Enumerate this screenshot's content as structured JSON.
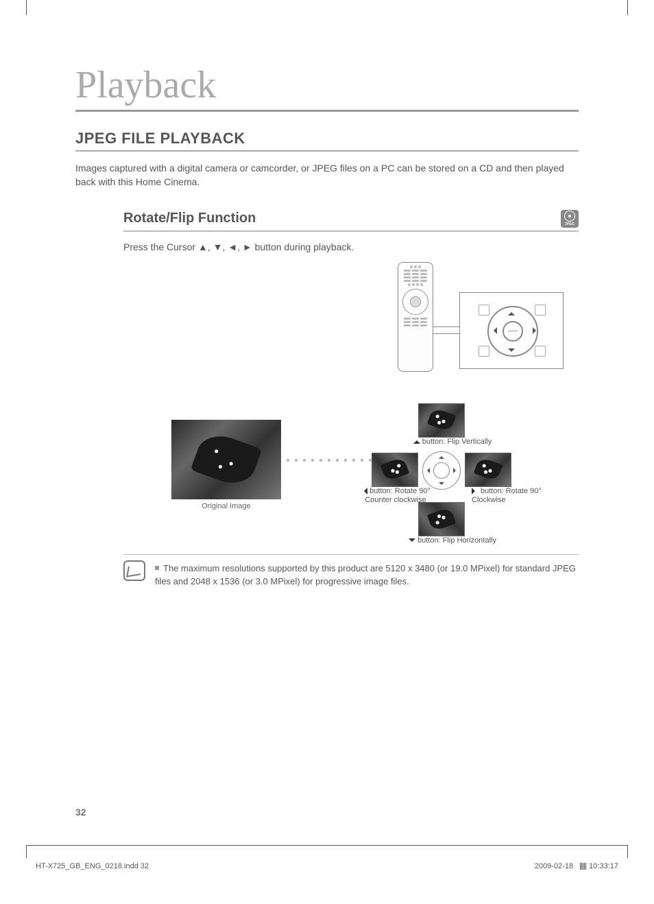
{
  "chapter_title": "Playback",
  "section_title": "JPEG FILE PLAYBACK",
  "intro_text": "Images captured with a digital camera or camcorder, or JPEG files on a PC can be stored on a CD and then played back with this Home Cinema.",
  "subsection_title": "Rotate/Flip Function",
  "jpeg_badge": "JPEG",
  "instruction_prefix": "Press the Cursor ",
  "instruction_suffix": " button during playback.",
  "arrows_sep": ", ",
  "enter_label": "ENTER",
  "original_caption": "Original Image",
  "labels": {
    "up": "button: Flip Vertically",
    "down": "button: Flip Horizontally",
    "left_line1": "button: Rotate 90°",
    "left_line2": "Counter clockwise",
    "right_line1": "button: Rotate 90°",
    "right_line2": "Clockwise"
  },
  "note_text": "The maximum resolutions supported by this product are 5120 x 3480 (or 19.0 MPixel) for standard JPEG files and 2048 x 1536 (or 3.0 MPixel) for progressive image files.",
  "page_number": "32",
  "footer_file": "HT-X725_GB_ENG_0218.indd   32",
  "footer_date": "2009-02-18",
  "footer_time": "10:33:17"
}
